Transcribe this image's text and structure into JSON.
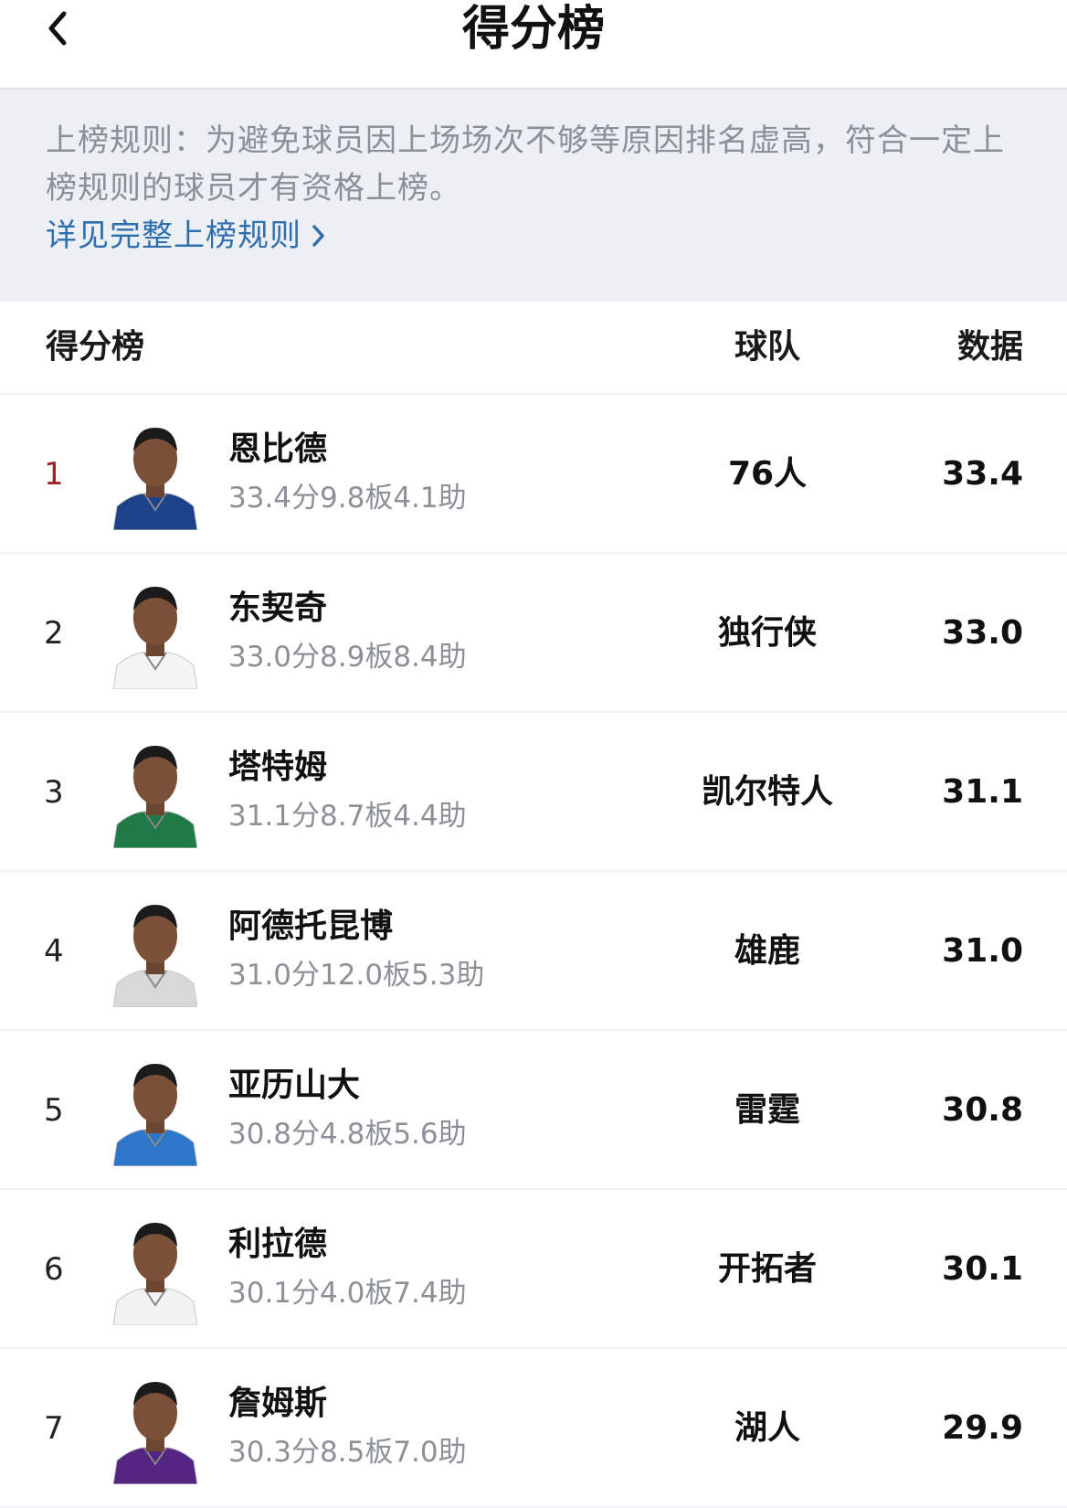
{
  "header": {
    "title": "得分榜"
  },
  "notice": {
    "text": "上榜规则：为避免球员因上场场次不够等原因排名虚高，符合一定上榜规则的球员才有资格上榜。",
    "link": "详见完整上榜规则"
  },
  "table": {
    "col_rank": "得分榜",
    "col_team": "球队",
    "col_data": "数据"
  },
  "colors": {
    "accent_rank": "#a3202a",
    "link": "#2f6fb0"
  },
  "rows": [
    {
      "rank": "1",
      "name": "恩比德",
      "stats": "33.4分9.8板4.1助",
      "team": "76人",
      "value": "33.4",
      "jersey": "#1d428a"
    },
    {
      "rank": "2",
      "name": "东契奇",
      "stats": "33.0分8.9板8.4助",
      "team": "独行侠",
      "value": "33.0",
      "jersey": "#f4f4f4"
    },
    {
      "rank": "3",
      "name": "塔特姆",
      "stats": "31.1分8.7板4.4助",
      "team": "凯尔特人",
      "value": "31.1",
      "jersey": "#1f7a45"
    },
    {
      "rank": "4",
      "name": "阿德托昆博",
      "stats": "31.0分12.0板5.3助",
      "team": "雄鹿",
      "value": "31.0",
      "jersey": "#d8d8d8"
    },
    {
      "rank": "5",
      "name": "亚历山大",
      "stats": "30.8分4.8板5.6助",
      "team": "雷霆",
      "value": "30.8",
      "jersey": "#2b76c9"
    },
    {
      "rank": "6",
      "name": "利拉德",
      "stats": "30.1分4.0板7.4助",
      "team": "开拓者",
      "value": "30.1",
      "jersey": "#f2f2f2"
    },
    {
      "rank": "7",
      "name": "詹姆斯",
      "stats": "30.3分8.5板7.0助",
      "team": "湖人",
      "value": "29.9",
      "jersey": "#552583"
    }
  ]
}
